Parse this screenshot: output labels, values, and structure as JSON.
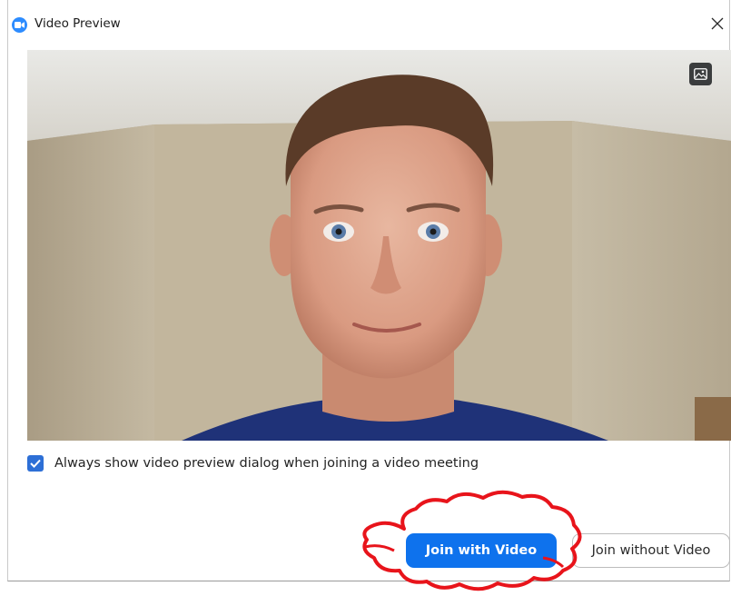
{
  "window": {
    "title": "Video Preview",
    "app_icon": "zoom-camera-icon",
    "close_icon": "close-icon"
  },
  "video": {
    "background_toggle_icon": "image-background-icon"
  },
  "options": {
    "always_show_preview": {
      "label": "Always show video preview dialog when joining a video meeting",
      "checked": true
    }
  },
  "buttons": {
    "join_with_video": "Join with Video",
    "join_without_video": "Join without Video"
  },
  "colors": {
    "accent": "#0e72ed",
    "checkbox": "#2d6fd6",
    "annotation": "#e8141b"
  }
}
